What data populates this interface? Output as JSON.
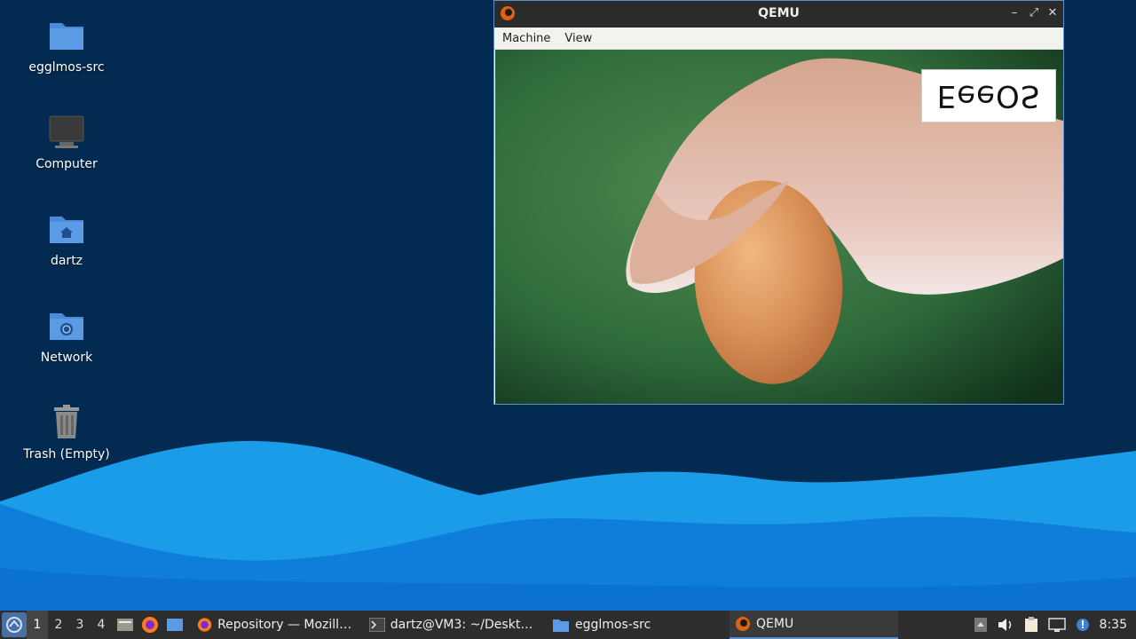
{
  "desktop": {
    "icons": [
      {
        "label": "egglmos-src",
        "icon": "folder-icon"
      },
      {
        "label": "Computer",
        "icon": "computer-icon"
      },
      {
        "label": "dartz",
        "icon": "home-folder-icon"
      },
      {
        "label": "Network",
        "icon": "network-folder-icon"
      },
      {
        "label": "Trash (Empty)",
        "icon": "trash-icon"
      }
    ]
  },
  "qemu_window": {
    "title": "QEMU",
    "menu": [
      "Machine",
      "View"
    ],
    "screen_text": "EeeOS"
  },
  "taskbar": {
    "workspaces": [
      "1",
      "2",
      "3",
      "4"
    ],
    "active_workspace": "1",
    "tasks": [
      {
        "label": "Repository — Mozilla ...",
        "icon": "firefox-icon"
      },
      {
        "label": "dartz@VM3: ~/Deskto...",
        "icon": "terminal-icon"
      },
      {
        "label": "egglmos-src",
        "icon": "folder-icon"
      },
      {
        "label": "QEMU",
        "icon": "qemu-icon"
      }
    ],
    "clock": "8:35"
  },
  "colors": {
    "desktop_bg": "#032b52",
    "wave_light": "#1aa3f0",
    "wave_dark": "#0d6fd6",
    "taskbar_bg": "#2d2d2d"
  }
}
